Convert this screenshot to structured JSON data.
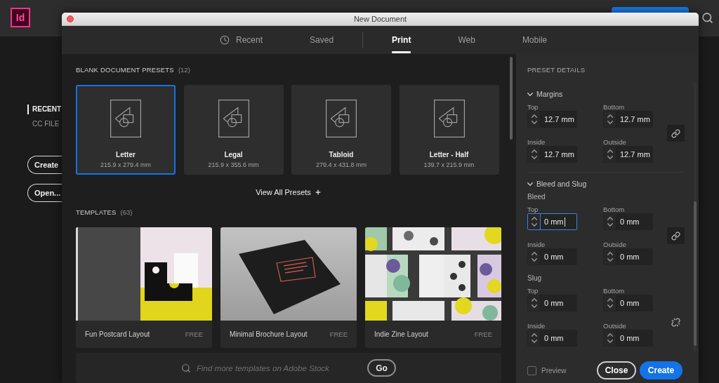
{
  "app": {
    "logo": "Id",
    "sidebar": {
      "items": [
        {
          "label": "RECENT",
          "selected": true
        },
        {
          "label": "CC FILE",
          "selected": false
        }
      ],
      "buttons": [
        "Create",
        "Open..."
      ]
    }
  },
  "dialog": {
    "title": "New Document",
    "tab_groups": [
      [
        {
          "label": "Recent",
          "kind": "history",
          "selected": false
        },
        {
          "label": "Saved",
          "kind": "plain",
          "selected": false
        }
      ],
      [
        {
          "label": "Print",
          "kind": "plain",
          "selected": true
        },
        {
          "label": "Web",
          "kind": "plain",
          "selected": false
        },
        {
          "label": "Mobile",
          "kind": "plain",
          "selected": false
        }
      ]
    ],
    "presets": {
      "title": "BLANK DOCUMENT PRESETS",
      "count": "(12)",
      "items": [
        {
          "name": "Letter",
          "size": "215.9 x 279.4 mm",
          "selected": true
        },
        {
          "name": "Legal",
          "size": "215.9 x 355.6 mm",
          "selected": false
        },
        {
          "name": "Tabloid",
          "size": "279.4 x 431.8 mm",
          "selected": false
        },
        {
          "name": "Letter - Half",
          "size": "139.7 x 215.9 mm",
          "selected": false
        }
      ],
      "view_all": "View All Presets"
    },
    "templates": {
      "title": "TEMPLATES",
      "count": "(63)",
      "items": [
        {
          "name": "Fun Postcard Layout",
          "price": "FREE",
          "kind": "postcard"
        },
        {
          "name": "Minimal Brochure Layout",
          "price": "FREE",
          "kind": "brochure"
        },
        {
          "name": "Indie Zine Layout",
          "price": "FREE",
          "kind": "zine"
        }
      ]
    },
    "stock_search": {
      "placeholder": "Find more templates on Adobe Stock",
      "button": "Go"
    },
    "preset_details": {
      "title": "PRESET DETAILS",
      "sections": [
        {
          "title": "Margins",
          "expanded": true,
          "groups": [
            {
              "linked": true,
              "fields": [
                {
                  "label": "Top",
                  "value": "12.7 mm",
                  "focused": false
                },
                {
                  "label": "Bottom",
                  "value": "12.7 mm",
                  "focused": false
                },
                {
                  "label": "Inside",
                  "value": "12.7 mm",
                  "focused": false
                },
                {
                  "label": "Outside",
                  "value": "12.7 mm",
                  "focused": false
                }
              ]
            }
          ]
        },
        {
          "title": "Bleed and Slug",
          "expanded": true,
          "groups": [
            {
              "label": "Bleed",
              "linked": true,
              "fields": [
                {
                  "label": "Top",
                  "value": "0 mm",
                  "focused": true
                },
                {
                  "label": "Bottom",
                  "value": "0 mm",
                  "focused": false
                },
                {
                  "label": "Inside",
                  "value": "0 mm",
                  "focused": false
                },
                {
                  "label": "Outside",
                  "value": "0 mm",
                  "focused": false
                }
              ]
            },
            {
              "label": "Slug",
              "linked": false,
              "fields": [
                {
                  "label": "Top",
                  "value": "0 mm",
                  "focused": false
                },
                {
                  "label": "Bottom",
                  "value": "0 mm",
                  "focused": false
                },
                {
                  "label": "Inside",
                  "value": "0 mm",
                  "focused": false
                },
                {
                  "label": "Outside",
                  "value": "0 mm",
                  "focused": false
                }
              ]
            }
          ]
        }
      ]
    },
    "footer": {
      "preview": {
        "label": "Preview",
        "checked": false
      },
      "buttons": [
        {
          "label": "Close",
          "kind": "secondary"
        },
        {
          "label": "Create",
          "kind": "primary"
        }
      ]
    }
  }
}
